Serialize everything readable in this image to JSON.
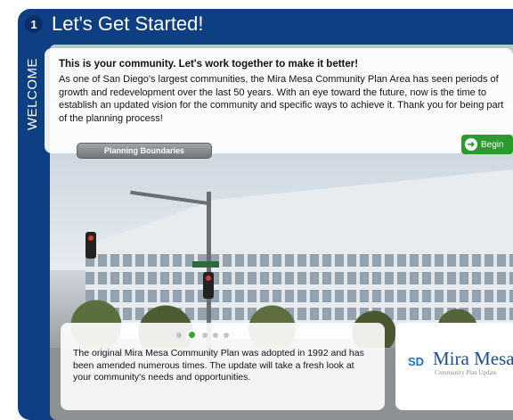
{
  "header": {
    "step_number": "1",
    "title": "Let's Get Started!"
  },
  "sidebar": {
    "label": "WELCOME"
  },
  "intro": {
    "heading": "This is your community. Let's work together to make it better!",
    "body": "As one of San Diego's largest communities, the Mira Mesa Community Plan Area has seen periods of growth and redevelopment over the last 50 years. With an eye toward the future, now is the time to establish an updated vision for the community and specific ways to achieve it. Thank you for being part of the planning process!"
  },
  "buttons": {
    "boundaries_label": "Planning Boundaries",
    "begin_label": "Begin"
  },
  "carousel": {
    "slide_count": 5,
    "active_index": 1
  },
  "caption": {
    "text": "The original Mira Mesa Community Plan was adopted in 1992 and has been amended numerous times. The update will take a fresh look at your community's needs and opportunities."
  },
  "logo": {
    "mark": "SD",
    "name": "Mira Mesa",
    "subtitle": "Community Plan Update"
  },
  "colors": {
    "frame": "#0d3f82",
    "begin": "#2d9a2f"
  }
}
